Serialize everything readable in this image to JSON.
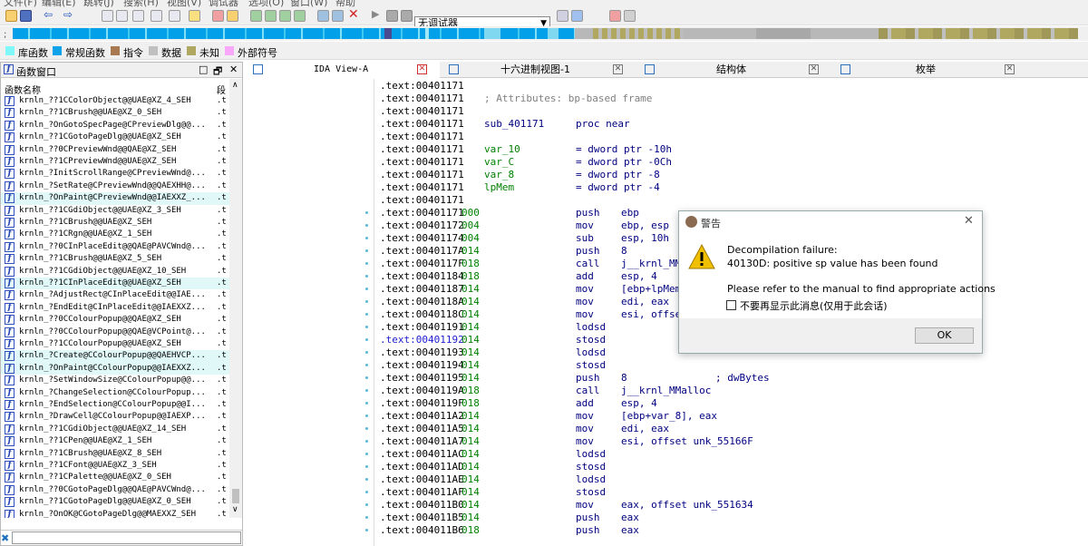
{
  "menu": [
    "文件(F)",
    "编辑(E)",
    "跳转(J)",
    "搜索(H)",
    "视图(V)",
    "调试器",
    "选项(O)",
    "窗口(W)",
    "帮助"
  ],
  "toolbar": {
    "debugger_select": "无调试器"
  },
  "legend": [
    {
      "label": "库函数",
      "color": "#80f8f8"
    },
    {
      "label": "常规函数",
      "color": "#0ea2e8"
    },
    {
      "label": "指令",
      "color": "#a87850"
    },
    {
      "label": "数据",
      "color": "#c0c0c0"
    },
    {
      "label": "未知",
      "color": "#b0a860"
    },
    {
      "label": "外部符号",
      "color": "#f8a8f8"
    }
  ],
  "functions_panel": {
    "title": "函数窗口",
    "col_name": "函数名称",
    "col_segment": "段",
    "items": [
      {
        "name": "krnln_??1CColorObject@@UAE@XZ_4_SEH",
        "seg": ".t",
        "hl": false
      },
      {
        "name": "krnln_??1CBrush@@UAE@XZ_0_SEH",
        "seg": ".t",
        "hl": false
      },
      {
        "name": "krnln_?OnGotoSpecPage@CPreviewDlg@@...",
        "seg": ".t",
        "hl": false
      },
      {
        "name": "krnln_??1CGotoPageDlg@@UAE@XZ_SEH",
        "seg": ".t",
        "hl": false
      },
      {
        "name": "krnln_??0CPreviewWnd@@QAE@XZ_SEH",
        "seg": ".t",
        "hl": false
      },
      {
        "name": "krnln_??1CPreviewWnd@@UAE@XZ_SEH",
        "seg": ".t",
        "hl": false
      },
      {
        "name": "krnln_?InitScrollRange@CPreviewWnd@...",
        "seg": ".t",
        "hl": false
      },
      {
        "name": "krnln_?SetRate@CPreviewWnd@@QAEXHH@...",
        "seg": ".t",
        "hl": false
      },
      {
        "name": "krnln_?OnPaint@CPreviewWnd@@IAEXXZ_...",
        "seg": ".t",
        "hl": true
      },
      {
        "name": "krnln_??1CGdiObject@@UAE@XZ_3_SEH",
        "seg": ".t",
        "hl": false
      },
      {
        "name": "krnln_??1CBrush@@UAE@XZ_SEH",
        "seg": ".t",
        "hl": false
      },
      {
        "name": "krnln_??1CRgn@@UAE@XZ_1_SEH",
        "seg": ".t",
        "hl": false
      },
      {
        "name": "krnln_??0CInPlaceEdit@@QAE@PAVCWnd@...",
        "seg": ".t",
        "hl": false
      },
      {
        "name": "krnln_??1CBrush@@UAE@XZ_5_SEH",
        "seg": ".t",
        "hl": false
      },
      {
        "name": "krnln_??1CGdiObject@@UAE@XZ_10_SEH",
        "seg": ".t",
        "hl": false
      },
      {
        "name": "krnln_??1CInPlaceEdit@@UAE@XZ_SEH",
        "seg": ".t",
        "hl": true
      },
      {
        "name": "krnln_?AdjustRect@CInPlaceEdit@@IAE...",
        "seg": ".t",
        "hl": false
      },
      {
        "name": "krnln_?EndEdit@CInPlaceEdit@@IAEXXZ...",
        "seg": ".t",
        "hl": false
      },
      {
        "name": "krnln_??0CColourPopup@@QAE@XZ_SEH",
        "seg": ".t",
        "hl": false
      },
      {
        "name": "krnln_??0CColourPopup@@QAE@VCPoint@...",
        "seg": ".t",
        "hl": false
      },
      {
        "name": "krnln_??1CColourPopup@@UAE@XZ_SEH",
        "seg": ".t",
        "hl": false
      },
      {
        "name": "krnln_?Create@CColourPopup@@QAEHVCP...",
        "seg": ".t",
        "hl": true
      },
      {
        "name": "krnln_?OnPaint@CColourPopup@@IAEXXZ...",
        "seg": ".t",
        "hl": true
      },
      {
        "name": "krnln_?SetWindowSize@CColourPopup@@...",
        "seg": ".t",
        "hl": false
      },
      {
        "name": "krnln_?ChangeSelection@CColourPopup...",
        "seg": ".t",
        "hl": false
      },
      {
        "name": "krnln_?EndSelection@CColourPopup@@I...",
        "seg": ".t",
        "hl": false
      },
      {
        "name": "krnln_?DrawCell@CColourPopup@@IAEXP...",
        "seg": ".t",
        "hl": false
      },
      {
        "name": "krnln_??1CGdiObject@@UAE@XZ_14_SEH",
        "seg": ".t",
        "hl": false
      },
      {
        "name": "krnln_??1CPen@@UAE@XZ_1_SEH",
        "seg": ".t",
        "hl": false
      },
      {
        "name": "krnln_??1CBrush@@UAE@XZ_8_SEH",
        "seg": ".t",
        "hl": false
      },
      {
        "name": "krnln_??1CFont@@UAE@XZ_3_SEH",
        "seg": ".t",
        "hl": false
      },
      {
        "name": "krnln_??1CPalette@@UAE@XZ_0_SEH",
        "seg": ".t",
        "hl": false
      },
      {
        "name": "krnln_??0CGotoPageDlg@@QAE@PAVCWnd@...",
        "seg": ".t",
        "hl": false
      },
      {
        "name": "krnln_??1CGotoPageDlg@@UAE@XZ_0_SEH",
        "seg": ".t",
        "hl": false
      },
      {
        "name": "krnln_?OnOK@CGotoPageDlg@@MAEXXZ_SEH",
        "seg": ".t",
        "hl": false
      }
    ]
  },
  "tabs": [
    {
      "label": "IDA View-A"
    },
    {
      "label": "十六进制视图-1"
    },
    {
      "label": "结构体"
    },
    {
      "label": "枚举"
    }
  ],
  "code_lines": [
    {
      "kind": "addr",
      "addr": ".text:00401171"
    },
    {
      "kind": "attr",
      "addr": ".text:00401171",
      "text": "; Attributes: bp-based frame"
    },
    {
      "kind": "addr",
      "addr": ".text:00401171"
    },
    {
      "kind": "proc",
      "addr": ".text:00401171",
      "label": "sub_401171",
      "mn": "proc near"
    },
    {
      "kind": "addr",
      "addr": ".text:00401171"
    },
    {
      "kind": "var",
      "addr": ".text:00401171",
      "label": "var_10",
      "eq": "= dword ptr -10h"
    },
    {
      "kind": "var",
      "addr": ".text:00401171",
      "label": "var_C",
      "eq": "= dword ptr -0Ch"
    },
    {
      "kind": "var",
      "addr": ".text:00401171",
      "label": "var_8",
      "eq": "= dword ptr -8"
    },
    {
      "kind": "var",
      "addr": ".text:00401171",
      "label": "lpMem",
      "eq": "= dword ptr -4"
    },
    {
      "kind": "addr",
      "addr": ".text:00401171"
    },
    {
      "kind": "ins",
      "addr": ".text:00401171",
      "sp": "000",
      "mn": "push",
      "op": "ebp",
      "dot": true
    },
    {
      "kind": "ins",
      "addr": ".text:00401172",
      "sp": "004",
      "mn": "mov",
      "op": "ebp, esp",
      "dot": true
    },
    {
      "kind": "ins",
      "addr": ".text:00401174",
      "sp": "004",
      "mn": "sub",
      "op": "esp, 10h",
      "dot": true
    },
    {
      "kind": "ins",
      "addr": ".text:0040117A",
      "sp": "014",
      "mn": "push",
      "op": "8",
      "dot": true
    },
    {
      "kind": "ins",
      "addr": ".text:0040117F",
      "sp": "018",
      "mn": "call",
      "op": "j__krnl_MMalloc",
      "dot": true
    },
    {
      "kind": "ins",
      "addr": ".text:00401184",
      "sp": "018",
      "mn": "add",
      "op": "esp, 4",
      "dot": true
    },
    {
      "kind": "ins",
      "addr": ".text:00401187",
      "sp": "014",
      "mn": "mov",
      "op": "[ebp+lpMem], eax",
      "dot": true
    },
    {
      "kind": "ins",
      "addr": ".text:0040118A",
      "sp": "014",
      "mn": "mov",
      "op": "edi, eax",
      "dot": true
    },
    {
      "kind": "ins",
      "addr": ".text:0040118C",
      "sp": "014",
      "mn": "mov",
      "op": "esi, offset unk_551658",
      "dot": true
    },
    {
      "kind": "ins",
      "addr": ".text:00401191",
      "sp": "014",
      "mn": "lodsd",
      "op": "",
      "dot": true
    },
    {
      "kind": "ins",
      "addr": ".text:00401192",
      "sp": "014",
      "mn": "stosd",
      "op": "",
      "dot": true,
      "blue": true
    },
    {
      "kind": "ins",
      "addr": ".text:00401193",
      "sp": "014",
      "mn": "lodsd",
      "op": "",
      "dot": true
    },
    {
      "kind": "ins",
      "addr": ".text:00401194",
      "sp": "014",
      "mn": "stosd",
      "op": "",
      "dot": true
    },
    {
      "kind": "ins",
      "addr": ".text:00401195",
      "sp": "014",
      "mn": "push",
      "op": "8",
      "cm": "; dwBytes",
      "dot": true
    },
    {
      "kind": "ins",
      "addr": ".text:0040119A",
      "sp": "018",
      "mn": "call",
      "op": "j__krnl_MMalloc",
      "dot": true
    },
    {
      "kind": "ins",
      "addr": ".text:0040119F",
      "sp": "018",
      "mn": "add",
      "op": "esp, 4",
      "dot": true
    },
    {
      "kind": "ins",
      "addr": ".text:004011A2",
      "sp": "014",
      "mn": "mov",
      "op": "[ebp+var_8], eax",
      "dot": true
    },
    {
      "kind": "ins",
      "addr": ".text:004011A5",
      "sp": "014",
      "mn": "mov",
      "op": "edi, eax",
      "dot": true
    },
    {
      "kind": "ins",
      "addr": ".text:004011A7",
      "sp": "014",
      "mn": "mov",
      "op": "esi, offset unk_55166F",
      "dot": true
    },
    {
      "kind": "ins",
      "addr": ".text:004011AC",
      "sp": "014",
      "mn": "lodsd",
      "op": "",
      "dot": true
    },
    {
      "kind": "ins",
      "addr": ".text:004011AD",
      "sp": "014",
      "mn": "stosd",
      "op": "",
      "dot": true
    },
    {
      "kind": "ins",
      "addr": ".text:004011AE",
      "sp": "014",
      "mn": "lodsd",
      "op": "",
      "dot": true
    },
    {
      "kind": "ins",
      "addr": ".text:004011AF",
      "sp": "014",
      "mn": "stosd",
      "op": "",
      "dot": true
    },
    {
      "kind": "ins",
      "addr": ".text:004011B0",
      "sp": "014",
      "mn": "mov",
      "op": "eax, offset unk_551634",
      "dot": true
    },
    {
      "kind": "ins",
      "addr": ".text:004011B5",
      "sp": "014",
      "mn": "push",
      "op": "eax",
      "dot": true
    },
    {
      "kind": "ins",
      "addr": ".text:004011B6",
      "sp": "018",
      "mn": "push",
      "op": "eax",
      "dot": true
    }
  ],
  "dialog": {
    "title": "警告",
    "line1": "Decompilation failure:",
    "line2": "40130D: positive sp value has been found",
    "line3": "Please refer to the manual to find appropriate actions",
    "checkbox": "不要再显示此消息(仅用于此会话)",
    "ok": "OK"
  },
  "colors": {
    "navbar": "#02a0e8",
    "accent_blue": "#000080",
    "sp_green": "#008000",
    "dialog_warn": "#f0c000"
  }
}
